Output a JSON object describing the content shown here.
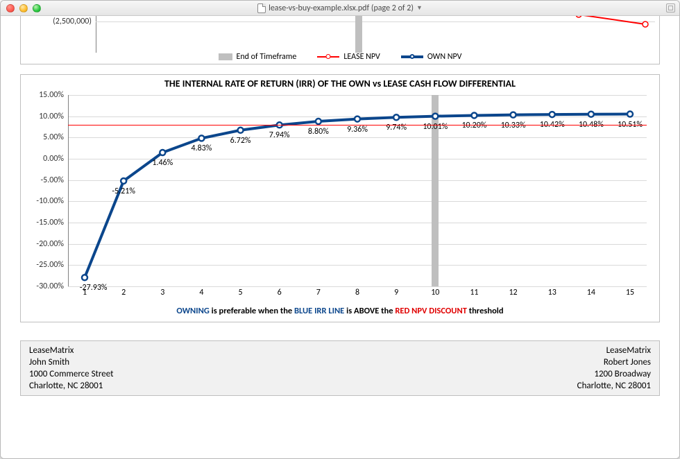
{
  "window": {
    "title": "lease-vs-buy-example.xlsx.pdf (page 2 of 2)"
  },
  "top_chart": {
    "visible_tick": "(2,500,000)",
    "legend": {
      "eot": "End of Timeframe",
      "lease": "LEASE NPV",
      "own": "OWN NPV"
    }
  },
  "irr": {
    "title": "THE INTERNAL RATE OF RETURN (IRR) OF THE OWN vs LEASE CASH FLOW DIFFERENTIAL",
    "caption": {
      "part1": "OWNING",
      "part2": " is preferable when the ",
      "part3": "BLUE IRR LINE",
      "part4": " is ",
      "part5": "ABOVE",
      "part6": " the ",
      "part7": "RED NPV DISCOUNT",
      "part8": " threshold"
    }
  },
  "footer": {
    "left": {
      "company": "LeaseMatrix",
      "name": "John Smith",
      "address1": "1000 Commerce Street",
      "address2": "Charlotte, NC 28001"
    },
    "right": {
      "company": "LeaseMatrix",
      "name": "Robert Jones",
      "address1": "1200 Broadway",
      "address2": "Charlotte, NC 28001"
    }
  },
  "chart_data": {
    "type": "line",
    "title": "THE INTERNAL RATE OF RETURN (IRR) OF THE OWN vs LEASE CASH FLOW DIFFERENTIAL",
    "xlabel": "",
    "ylabel": "",
    "x": [
      1,
      2,
      3,
      4,
      5,
      6,
      7,
      8,
      9,
      10,
      11,
      12,
      13,
      14,
      15
    ],
    "series": [
      {
        "name": "IRR",
        "values_pct": [
          -27.93,
          -5.21,
          1.46,
          4.83,
          6.72,
          7.94,
          8.8,
          9.36,
          9.74,
          10.01,
          10.2,
          10.33,
          10.42,
          10.48,
          10.51
        ],
        "value_labels": [
          "-27.93%",
          "-5.21%",
          "1.46%",
          "4.83%",
          "6.72%",
          "7.94%",
          "8.80%",
          "9.36%",
          "9.74%",
          "10.01%",
          "10.20%",
          "10.33%",
          "10.42%",
          "10.48%",
          "10.51%"
        ]
      }
    ],
    "threshold_pct": 8.0,
    "end_of_timeframe_x": 10,
    "ylim": [
      -30,
      15
    ],
    "yticks": [
      -30,
      -25,
      -20,
      -15,
      -10,
      -5,
      0,
      5,
      10,
      15
    ],
    "ytick_labels": [
      "-30.00%",
      "-25.00%",
      "-20.00%",
      "-15.00%",
      "-10.00%",
      "-5.00%",
      "0.00%",
      "5.00%",
      "10.00%",
      "15.00%"
    ]
  }
}
